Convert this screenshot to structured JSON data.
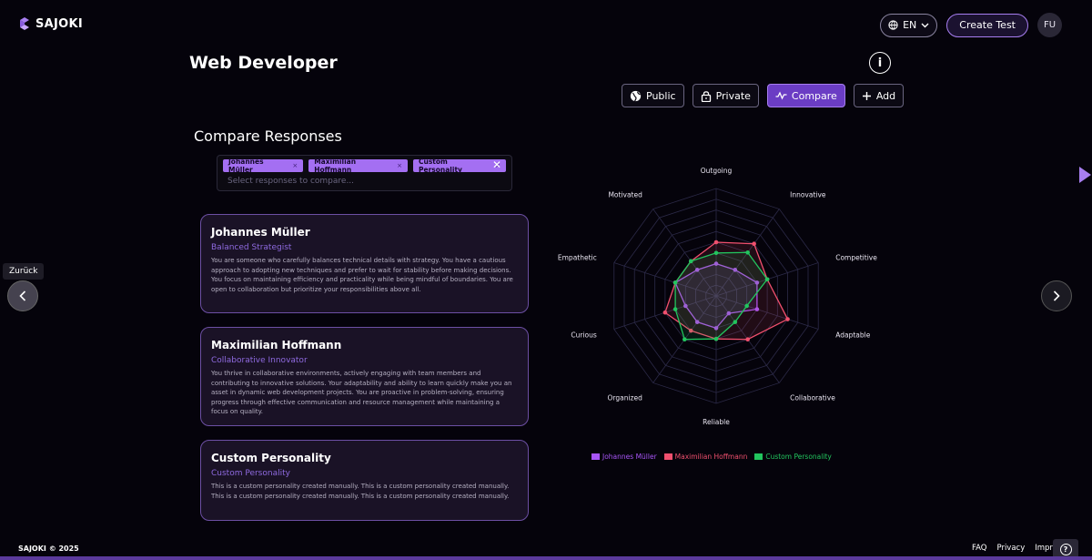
{
  "header": {
    "brand": "SAJOKI",
    "language": "EN",
    "create_label": "Create Test",
    "avatar_initials": "FU"
  },
  "page": {
    "title": "Web Developer",
    "info_glyph": "i"
  },
  "actions": [
    {
      "label": "Public",
      "icon": "globe-icon"
    },
    {
      "label": "Private",
      "icon": "lock-icon"
    },
    {
      "label": "Compare",
      "icon": "compare-icon",
      "active": true
    },
    {
      "label": "Add",
      "icon": "plus-icon"
    }
  ],
  "compare": {
    "title": "Compare Responses",
    "selected": [
      "Johannes Müller",
      "Maximilian Hoffmann",
      "Custom Personality"
    ],
    "placeholder": "Select responses to compare..."
  },
  "cards": [
    {
      "name": "Johannes Müller",
      "type": "Balanced Strategist",
      "description": "You are someone who carefully balances technical details with strategy. You have a cautious approach to adopting new techniques and prefer to wait for stability before making decisions. You focus on maintaining efficiency and practicality while being mindful of boundaries. You are open to collaboration but prioritize your responsibilities above all."
    },
    {
      "name": "Maximilian Hoffmann",
      "type": "Collaborative Innovator",
      "description": "You thrive in collaborative environments, actively engaging with team members and contributing to innovative solutions. Your adaptability and ability to learn quickly make you an asset in dynamic web development projects. You are proactive in problem-solving, ensuring progress through effective communication and resource management while maintaining a focus on quality."
    },
    {
      "name": "Custom Personality",
      "type": "Custom Personality",
      "description": "This is a custom personality created manually. This is a custom personality created manually. This is a custom personality created manually. This is a custom personality created manually."
    }
  ],
  "nav": {
    "back_tooltip": "Zurück"
  },
  "chart_data": {
    "type": "radar",
    "axes": [
      "Outgoing",
      "Innovative",
      "Competitive",
      "Adaptable",
      "Collaborative",
      "Reliable",
      "Organized",
      "Curious",
      "Empathetic",
      "Motivated"
    ],
    "rlim": [
      0,
      10
    ],
    "rings": 10,
    "series": [
      {
        "name": "Johannes Müller",
        "color": "#a855f7",
        "values": [
          3,
          3,
          4,
          4,
          2,
          3,
          3,
          3,
          4,
          3
        ]
      },
      {
        "name": "Maximilian Hoffmann",
        "color": "#f0506e",
        "values": [
          5,
          6,
          5,
          7,
          5,
          4,
          4,
          5,
          4,
          4
        ]
      },
      {
        "name": "Custom Personality",
        "color": "#22c55e",
        "values": [
          4,
          5,
          5,
          3,
          3,
          4,
          5,
          4,
          4,
          4
        ]
      }
    ],
    "legend_position": "bottom"
  },
  "footer": {
    "copyright": "SAJOKI © 2025",
    "links": [
      "FAQ",
      "Privacy",
      "Impri"
    ]
  },
  "colors": {
    "accent": "#a77ef0",
    "accent_dark": "#6b3dc4",
    "card_border": "#6c4fa3"
  }
}
